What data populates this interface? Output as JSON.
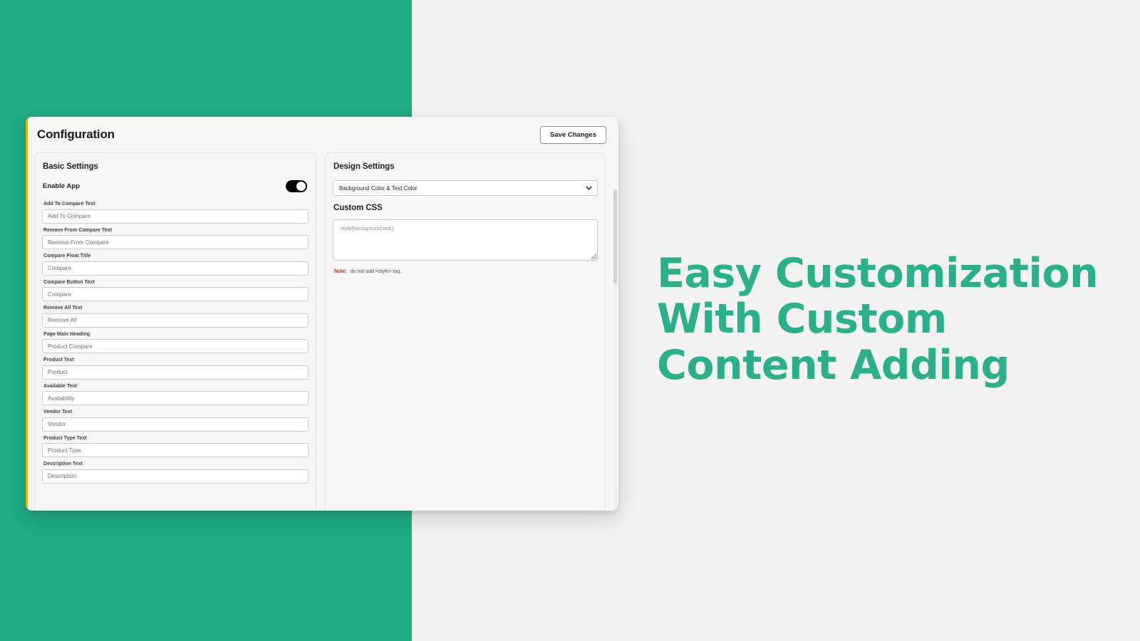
{
  "theme": {
    "brand_green": "#21ab85",
    "headline_green": "#2bb08b",
    "page_background": "#f2f2f2",
    "card_background": "#f6f6f7",
    "accent_stripe": "#e3b408",
    "note_red": "#d72c0d",
    "toggle_on": "#000000"
  },
  "marketing": {
    "line1": "Easy Customization",
    "line2": "With Custom",
    "line3": "Content Adding"
  },
  "card": {
    "title": "Configuration",
    "save_label": "Save Changes"
  },
  "basic_settings": {
    "section_title": "Basic Settings",
    "enable_app": {
      "label": "Enable App",
      "state": "on"
    },
    "fields": [
      {
        "label": "Add To Compare Text",
        "value": "Add To Compare"
      },
      {
        "label": "Remove From Compare Text",
        "value": "Remove From Compare"
      },
      {
        "label": "Compare Float Title",
        "value": "Compare"
      },
      {
        "label": "Compare Button Text",
        "value": "Compare"
      },
      {
        "label": "Remove All Text",
        "value": "Remove All"
      },
      {
        "label": "Page Main Heading",
        "value": "Product Compare"
      },
      {
        "label": "Product Text",
        "value": "Product"
      },
      {
        "label": "Available Text",
        "value": "Availability"
      },
      {
        "label": "Vendor Text",
        "value": "Vendor"
      },
      {
        "label": "Product Type Text",
        "value": "Product Type"
      },
      {
        "label": "Description Text",
        "value": "Description"
      }
    ]
  },
  "design_settings": {
    "section_title": "Design Settings",
    "color_select": {
      "selected": "Background Color & Text Color"
    },
    "custom_css": {
      "title": "Custom CSS",
      "placeholder": ".style{background:red;}",
      "value": "",
      "note_keyword": "Note:",
      "note_text": "do not add <style> tag."
    }
  }
}
